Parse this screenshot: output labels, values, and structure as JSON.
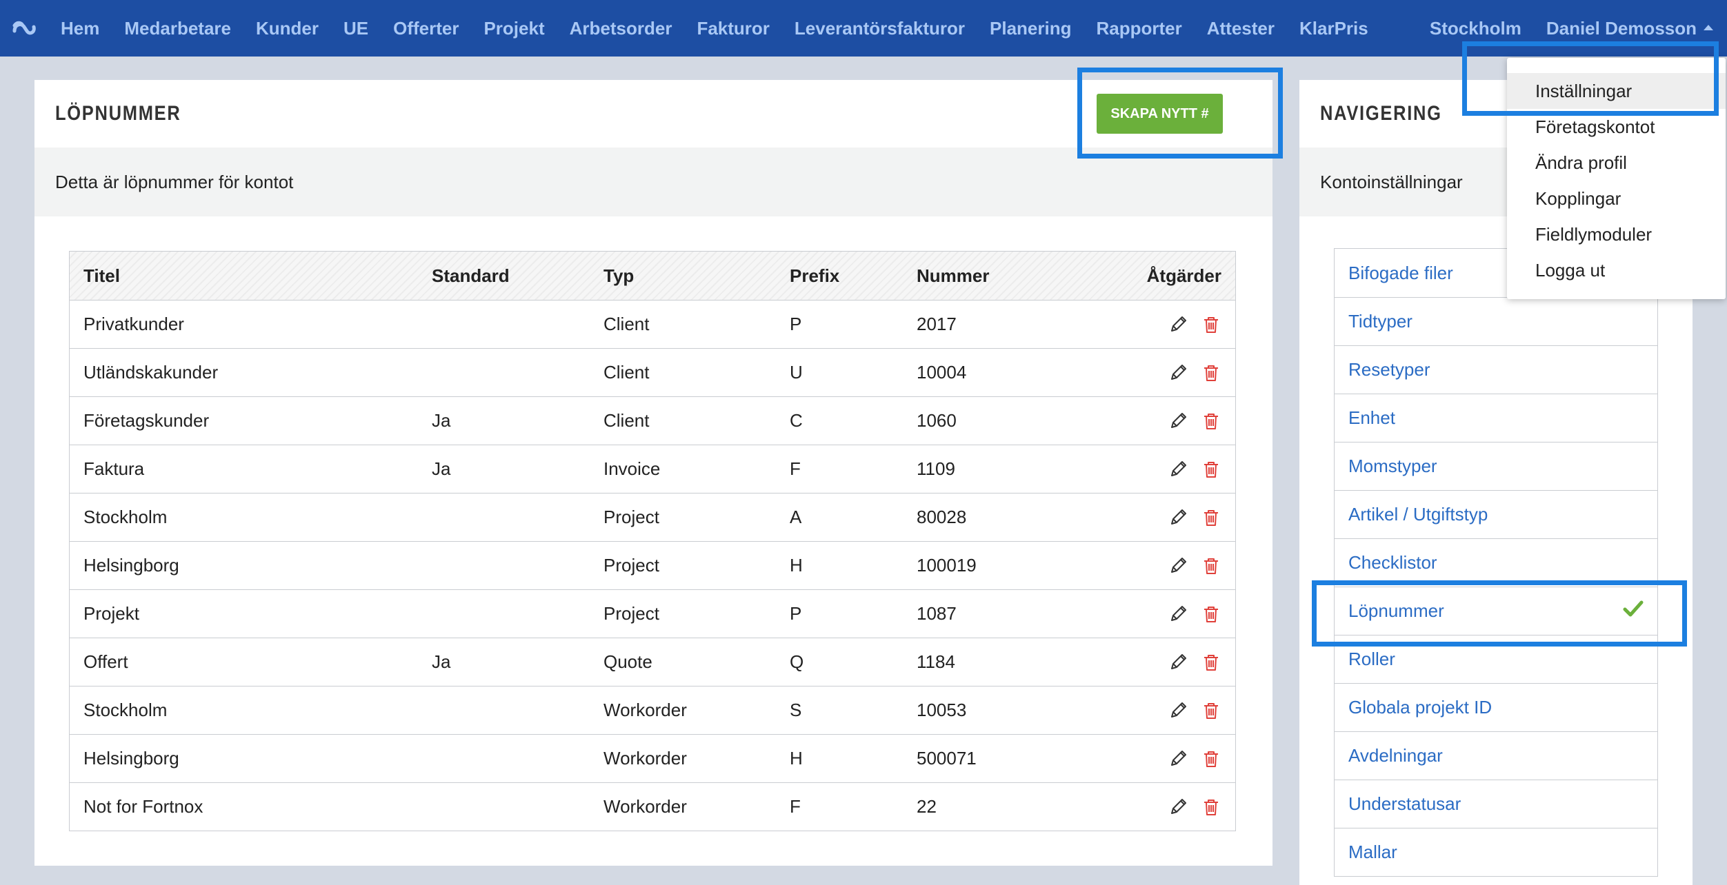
{
  "nav": {
    "items": [
      "Hem",
      "Medarbetare",
      "Kunder",
      "UE",
      "Offerter",
      "Projekt",
      "Arbetsorder",
      "Fakturor",
      "Leverantörsfakturor",
      "Planering",
      "Rapporter",
      "Attester",
      "KlarPris"
    ],
    "location": "Stockholm",
    "user": "Daniel Demosson"
  },
  "dropdown": {
    "items": [
      "Inställningar",
      "Företagskontot",
      "Ändra profil",
      "Kopplingar",
      "Fieldlymoduler",
      "Logga ut"
    ]
  },
  "main": {
    "title": "LÖPNUMMER",
    "subtitle": "Detta är löpnummer för kontot",
    "create_label": "SKAPA NYTT #",
    "columns": [
      "Titel",
      "Standard",
      "Typ",
      "Prefix",
      "Nummer",
      "Åtgärder"
    ],
    "rows": [
      [
        "Privatkunder",
        "",
        "Client",
        "P",
        "2017"
      ],
      [
        "Utländskakunder",
        "",
        "Client",
        "U",
        "10004"
      ],
      [
        "Företagskunder",
        "Ja",
        "Client",
        "C",
        "1060"
      ],
      [
        "Faktura",
        "Ja",
        "Invoice",
        "F",
        "1109"
      ],
      [
        "Stockholm",
        "",
        "Project",
        "A",
        "80028"
      ],
      [
        "Helsingborg",
        "",
        "Project",
        "H",
        "100019"
      ],
      [
        "Projekt",
        "",
        "Project",
        "P",
        "1087"
      ],
      [
        "Offert",
        "Ja",
        "Quote",
        "Q",
        "1184"
      ],
      [
        "Stockholm",
        "",
        "Workorder",
        "S",
        "10053"
      ],
      [
        "Helsingborg",
        "",
        "Workorder",
        "H",
        "500071"
      ],
      [
        "Not for Fortnox",
        "",
        "Workorder",
        "F",
        "22"
      ]
    ]
  },
  "side": {
    "title": "NAVIGERING",
    "subtitle": "Kontoinställningar",
    "items": [
      "Bifogade filer",
      "Tidtyper",
      "Resetyper",
      "Enhet",
      "Momstyper",
      "Artikel / Utgiftstyp",
      "Checklistor",
      "Löpnummer",
      "Roller",
      "Globala projekt ID",
      "Avdelningar",
      "Understatusar",
      "Mallar"
    ],
    "active_index": 7
  },
  "colors": {
    "nav_bg": "#1d4ea3",
    "nav_text": "#a9c8f5",
    "button_green": "#6bb03b",
    "link_blue": "#2b6cc4",
    "delete_red": "#e0403a",
    "highlight": "#1c7fe0"
  }
}
